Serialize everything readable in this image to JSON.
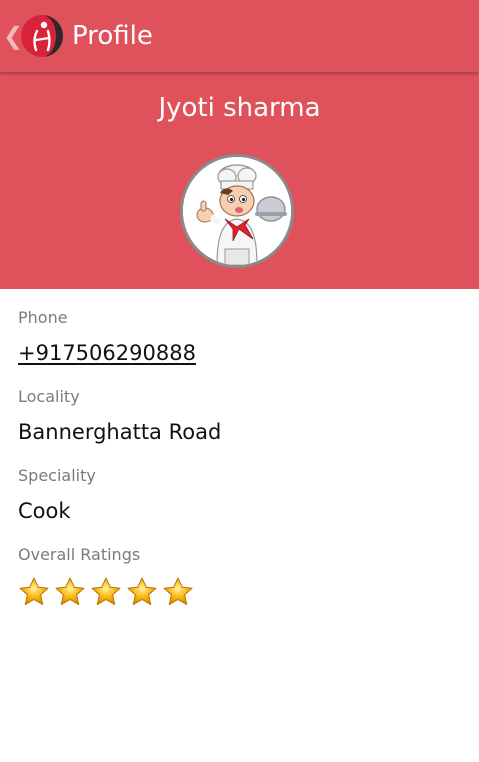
{
  "action_bar": {
    "title": "Profile",
    "back_glyph": "❮",
    "logo_icon": "app-logo-icon"
  },
  "profile": {
    "name": "Jyoti sharma",
    "avatar_icon": "chef-avatar-icon"
  },
  "fields": {
    "phone": {
      "label": "Phone",
      "value": "+917506290888"
    },
    "locality": {
      "label": "Locality",
      "value": "Bannerghatta Road"
    },
    "speciality": {
      "label": "Speciality",
      "value": "Cook"
    },
    "ratings": {
      "label": "Overall Ratings",
      "stars": 5,
      "max_stars": 5
    }
  },
  "colors": {
    "primary": "#e0525b",
    "star": "#f7b80f"
  }
}
